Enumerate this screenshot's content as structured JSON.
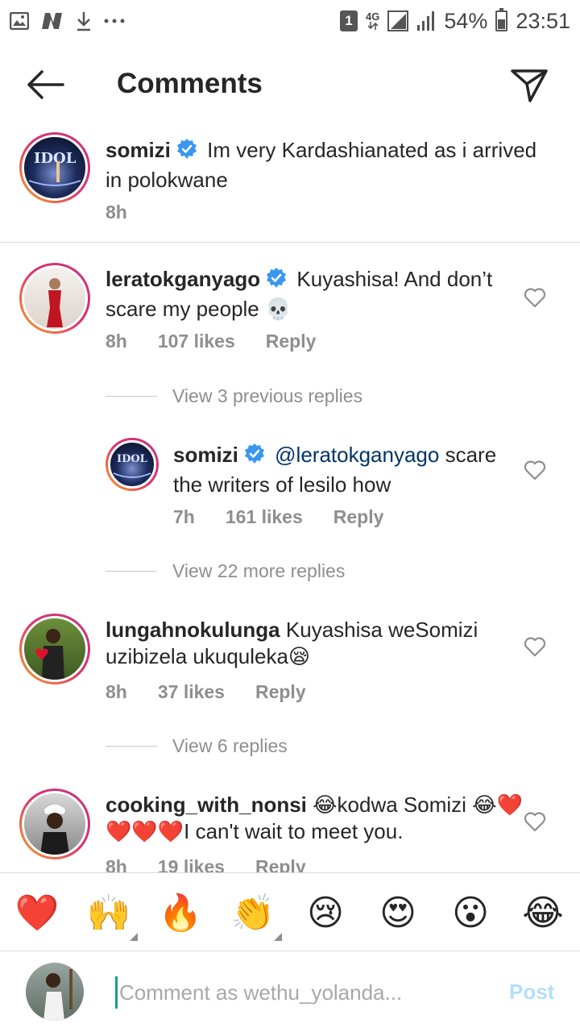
{
  "status_bar": {
    "sim_slot": "1",
    "network": "4G",
    "battery": "54%",
    "battery_level": 0.54,
    "time": "23:51"
  },
  "header": {
    "title": "Comments"
  },
  "caption": {
    "username": "somizi",
    "text": "Im very Kardashianated  as i arrived in polokwane",
    "time": "8h"
  },
  "comments": [
    {
      "username": "leratokganyago",
      "verified": true,
      "text": "Kuyashisa! And don’t scare my people 💀",
      "time": "8h",
      "likes": "107 likes",
      "reply_label": "Reply",
      "view_replies": "View 3 previous replies"
    },
    {
      "username": "somizi",
      "verified": true,
      "mention": "@leratokganyago",
      "text": "scare the writers of lesilo how",
      "time": "7h",
      "likes": "161 likes",
      "reply_label": "Reply",
      "view_replies": "View 22 more replies"
    },
    {
      "username": "lungahnokulunga",
      "text": "Kuyashisa weSomizi uzibizela ukuquleka😪",
      "time": "8h",
      "likes": "37 likes",
      "reply_label": "Reply",
      "view_replies": "View 6 replies"
    },
    {
      "username": "cooking_with_nonsi",
      "text": "😂kodwa Somizi 😂❤️❤️❤️❤️I can't wait to meet you.",
      "time": "8h",
      "likes": "19 likes",
      "reply_label": "Reply"
    }
  ],
  "emoji_bar": [
    "❤️",
    "🙌",
    "🔥",
    "👏",
    "😢",
    "😍",
    "😮",
    "😂"
  ],
  "compose": {
    "placeholder": "Comment as wethu_yolanda...",
    "post_label": "Post"
  },
  "colors": {
    "verified": "#3897f0",
    "mention": "#003569",
    "meta": "#8e8e8e",
    "post_disabled": "#b2dffc"
  }
}
